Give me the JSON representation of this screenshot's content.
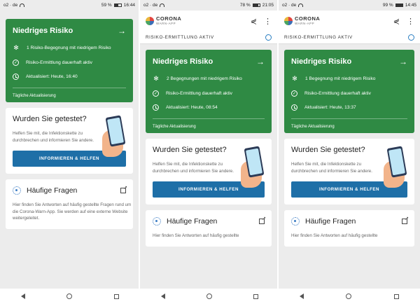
{
  "screens": [
    {
      "status": {
        "carrier": "o2 · de",
        "battery": "59 %",
        "battery_level": 0.59,
        "time": "16:44"
      },
      "risk": {
        "title": "Niedriges Risiko",
        "rows": [
          "1 Risiko-Begegnung mit niedrigem Risiko",
          "Risiko-Ermittlung dauerhaft aktiv",
          "Aktualisiert: Heute, 16:40"
        ],
        "footer": "Tägliche Aktualisierung"
      },
      "test": {
        "title": "Wurden Sie getestet?",
        "text": "Helfen Sie mit, die Infektionskette zu durchbrechen und informieren Sie andere.",
        "button": "INFORMIEREN & HELFEN"
      },
      "faq": {
        "title": "Häufige Fragen",
        "text": "Hier finden Sie Antworten auf häufig gestellte Fragen rund um die Corona-Warn-App. Sie werden auf eine externe Website weitergeleitet."
      }
    },
    {
      "status": {
        "carrier": "o2 · de",
        "battery": "78 %",
        "battery_level": 0.78,
        "time": "21:05"
      },
      "app": {
        "name": "CORONA",
        "subname": "WARN-APP"
      },
      "ermittlung": "RISIKO-ERMITTLUNG AKTIV",
      "risk": {
        "title": "Niedriges Risiko",
        "rows": [
          "2 Begegnungen mit niedrigem Risiko",
          "Risiko-Ermittlung dauerhaft aktiv",
          "Aktualisiert: Heute, 08:54"
        ],
        "footer": "Tägliche Aktualisierung"
      },
      "test": {
        "title": "Wurden Sie getestet?",
        "text": "Helfen Sie mit, die Infektionskette zu durchbrechen und informieren Sie andere.",
        "button": "INFORMIEREN & HELFEN"
      },
      "faq": {
        "title": "Häufige Fragen",
        "text": "Hier finden Sie Antworten auf häufig gestellte"
      }
    },
    {
      "status": {
        "carrier": "o2 · de",
        "battery": "99 %",
        "battery_level": 0.99,
        "time": "14:45"
      },
      "app": {
        "name": "CORONA",
        "subname": "WARN-APP"
      },
      "ermittlung": "RISIKO-ERMITTLUNG AKTIV",
      "risk": {
        "title": "Niedriges Risiko",
        "rows": [
          "1 Begegnung mit niedrigem Risiko",
          "Risiko-Ermittlung dauerhaft aktiv",
          "Aktualisiert: Heute, 13:37"
        ],
        "footer": "Tägliche Aktualisierung"
      },
      "test": {
        "title": "Wurden Sie getestet?",
        "text": "Helfen Sie mit, die Infektionskette zu durchbrechen und informieren Sie andere.",
        "button": "INFORMIEREN & HELFEN"
      },
      "faq": {
        "title": "Häufige Fragen",
        "text": "Hier finden Sie Antworten auf häufig gestellte"
      }
    }
  ],
  "colors": {
    "risk_green": "#2f8a44",
    "button_blue": "#1e6fa7",
    "accent_ring": "#2b7fc2"
  },
  "icons": {
    "share": "share-icon",
    "menu": "more-vert-icon",
    "arrow": "arrow-right-icon",
    "virus": "virus-icon",
    "external": "external-link-icon"
  }
}
